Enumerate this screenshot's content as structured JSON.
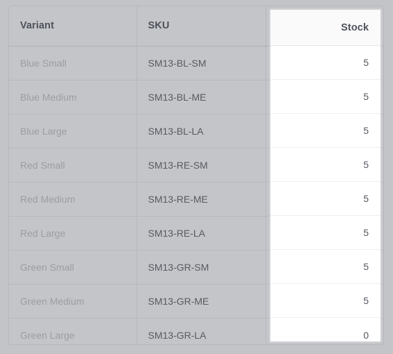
{
  "table": {
    "columns": [
      {
        "key": "variant",
        "label": "Variant",
        "align": "left"
      },
      {
        "key": "sku",
        "label": "SKU",
        "align": "left"
      },
      {
        "key": "stock",
        "label": "Stock",
        "align": "right"
      }
    ],
    "rows": [
      {
        "variant": "Blue Small",
        "sku": "SM13-BL-SM",
        "stock": "5"
      },
      {
        "variant": "Blue Medium",
        "sku": "SM13-BL-ME",
        "stock": "5"
      },
      {
        "variant": "Blue Large",
        "sku": "SM13-BL-LA",
        "stock": "5"
      },
      {
        "variant": "Red Small",
        "sku": "SM13-RE-SM",
        "stock": "5"
      },
      {
        "variant": "Red Medium",
        "sku": "SM13-RE-ME",
        "stock": "5"
      },
      {
        "variant": "Red Large",
        "sku": "SM13-RE-LA",
        "stock": "5"
      },
      {
        "variant": "Green Small",
        "sku": "SM13-GR-SM",
        "stock": "5"
      },
      {
        "variant": "Green Medium",
        "sku": "SM13-GR-ME",
        "stock": "5"
      },
      {
        "variant": "Green Large",
        "sku": "SM13-GR-LA",
        "stock": "0"
      }
    ]
  },
  "colors": {
    "page_background": "#c3c4c7",
    "table_background": "#c4c5c8",
    "stock_panel_background": "#ffffff",
    "stock_panel_header_background": "#fafafa",
    "header_text": "#4d525a",
    "variant_text": "#9a9da3",
    "sku_text": "#565a61",
    "stock_text": "#54585f",
    "row_divider": "#b6b8bd",
    "stock_row_divider": "#eceef3"
  }
}
